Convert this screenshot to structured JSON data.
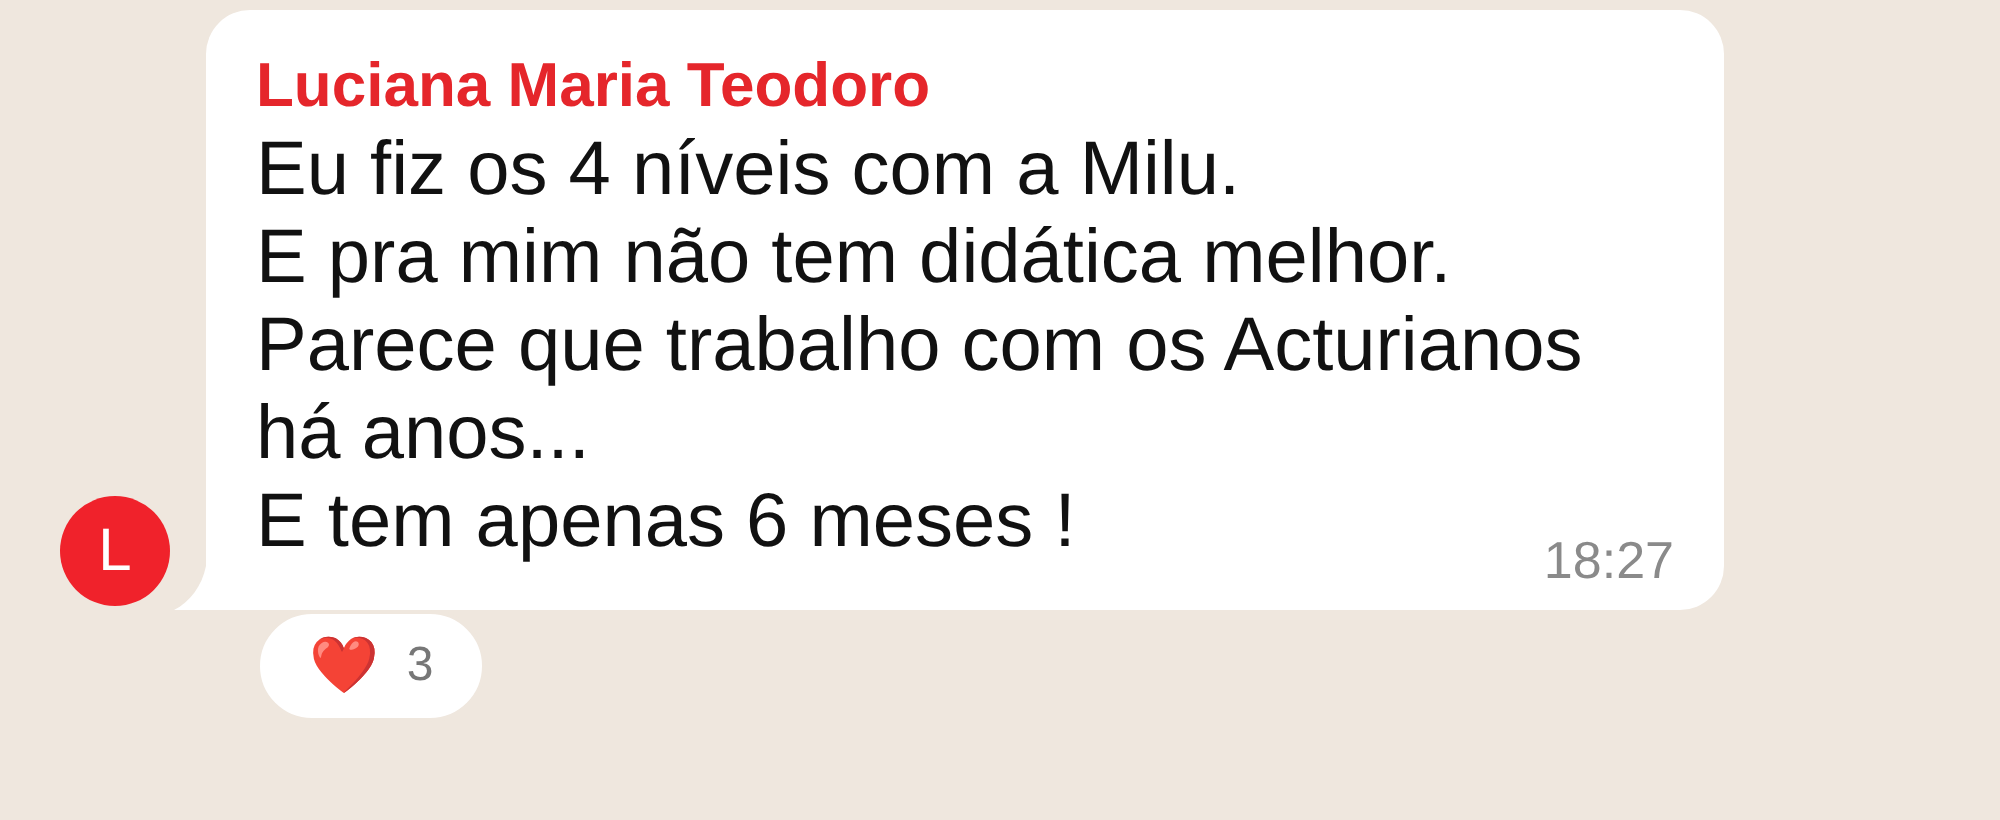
{
  "message": {
    "sender": "Luciana Maria Teodoro",
    "avatar_letter": "L",
    "lines": [
      "Eu fiz os 4 níveis com a Milu.",
      "E pra mim não tem didática melhor.",
      "Parece que trabalho com os Acturianos",
      "há anos...",
      "E tem apenas 6 meses !"
    ],
    "time": "18:27",
    "reaction": {
      "emoji": "❤️",
      "count": "3"
    }
  }
}
